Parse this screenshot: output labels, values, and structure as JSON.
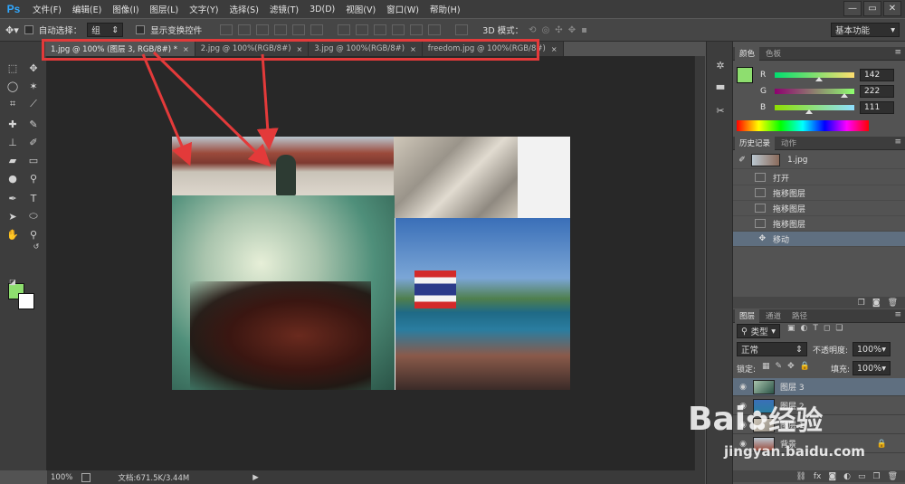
{
  "app": {
    "logo": "Ps"
  },
  "menu": [
    "文件(F)",
    "编辑(E)",
    "图像(I)",
    "图层(L)",
    "文字(Y)",
    "选择(S)",
    "滤镜(T)",
    "3D(D)",
    "视图(V)",
    "窗口(W)",
    "帮助(H)"
  ],
  "window_controls": [
    "—",
    "▭",
    "✕"
  ],
  "options": {
    "auto_select_label": "自动选择：",
    "auto_select_value": "组",
    "show_transform_label": "显示变换控件",
    "mode_3d_label": "3D 模式：",
    "workspace": "基本功能"
  },
  "tabs": [
    {
      "label": "1.jpg @ 100% (图层 3, RGB/8#) *",
      "close": "×"
    },
    {
      "label": "2.jpg @ 100%(RGB/8#)",
      "close": "×"
    },
    {
      "label": "3.jpg @ 100%(RGB/8#)",
      "close": "×"
    },
    {
      "label": "freedom.jpg @ 100%(RGB/8#)",
      "close": "×"
    }
  ],
  "status": {
    "zoom": "100%",
    "doc": "文档:671.5K/3.44M"
  },
  "color_panel": {
    "tabs": [
      "颜色",
      "色板"
    ],
    "channels": [
      {
        "name": "R",
        "value": "142",
        "fraction": 0.557
      },
      {
        "name": "G",
        "value": "222",
        "fraction": 0.871
      },
      {
        "name": "B",
        "value": "111",
        "fraction": 0.435
      }
    ],
    "foreground_color": "#8ede6f"
  },
  "history_panel": {
    "tabs": [
      "历史记录",
      "动作"
    ],
    "snapshot": "1.jpg",
    "items": [
      "打开",
      "拖移图层",
      "拖移图层",
      "拖移图层",
      "移动"
    ]
  },
  "layers_panel": {
    "tabs": [
      "图层",
      "通道",
      "路径"
    ],
    "filter": "类型",
    "blend_mode": "正常",
    "opacity_label": "不透明度:",
    "opacity": "100%",
    "lock_label": "锁定:",
    "fill_label": "填充:",
    "fill": "100%",
    "layers": [
      "图层 3",
      "图层 2",
      "图层 1",
      "背景"
    ]
  },
  "watermark": {
    "brand": "Bai",
    "brand_cn": "经验",
    "url": "jingyan.baidu.com"
  }
}
